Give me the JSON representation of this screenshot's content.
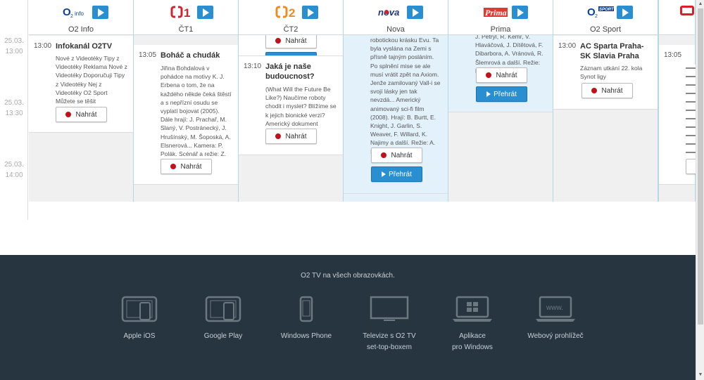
{
  "times": [
    "25.03.",
    "13:00",
    "25.03.",
    "13:30",
    "25.03.",
    "14:00"
  ],
  "channels": {
    "o2info": {
      "name": "O2 Info",
      "prog": {
        "time": "13:00",
        "title": "Infokanál O2TV",
        "desc": "Nové z Videotéky Tipy z Videotéky Reklama Nové z Videotéky Doporučuji Tipy z Videotéky Nej z Videotéky O2 Sport Můžete se těšit",
        "record": "Nahrát"
      }
    },
    "ct1": {
      "name": "ČT1",
      "prog": {
        "time": "13:05",
        "title": "Boháč a chudák",
        "desc": "Jiřina Bohdalová v pohádce na motivy K. J. Erbena o tom, že na každého někde čeká štěstí a s nepřízní osudu se vyplatí bojovat (2005). Dále hrají: J. Prachař, M. Slaný, V. Postránecký, J. Hrušínský, M. Šoposká, A. Elsnerová... Kamera: P. Polák. Scénář a režie: Z. Zelenka",
        "record": "Nahrát"
      }
    },
    "ct2": {
      "name": "ČT2",
      "prev_record": "Nahrát",
      "prog": {
        "time": "13:10",
        "title": "Jaká je naše budoucnost?",
        "desc": "(What Will the Future Be Like?) Naučíme roboty chodit i myslet? Blížíme se k jejich bionické verzi? Americký dokument",
        "record": "Nahrát"
      }
    },
    "nova": {
      "name": "Nova",
      "prog": {
        "desc": "robotickou krásku Evu. Ta byla vyslána na Zemi s přísně tajným posláním. Po splnění mise se ale musí vrátit zpět na Axiom. Jenže zamilovaný Vall-i se svojí lásky jen tak nevzdá... Americký animovaný sci-fi film (2008). Hrají: B. Burtt, E. Knight, J. Garlin, S. Weaver, F. Willard, K. Najimy a další. Režie: A. Stanton",
        "record": "Nahrát",
        "play": "Přehrát"
      }
    },
    "prima": {
      "name": "Prima",
      "prog": {
        "desc": "J. Petrýl, R. Kemr, V. Hlaváčová, J. Dítětová, F. Dibarbora, A. Vránová, R. Šlemrová a další. Režie: B. Zeman",
        "record": "Nahrát",
        "play": "Přehrát"
      }
    },
    "o2sport": {
      "name": "O2 Sport",
      "prog": {
        "time": "13:00",
        "title": "AC Sparta Praha-SK Slavia Praha",
        "desc": "Záznam utkání 22. kola Synot ligy",
        "record": "Nahrát"
      }
    },
    "partial": {
      "time": "13:05"
    }
  },
  "logos": {
    "o2info_small": "info",
    "ct1": "1",
    "ct2": "2",
    "nova": "nova",
    "prima": "Prima",
    "o2sport": "SPORT"
  },
  "footer": {
    "title": "O2 TV na všech obrazovkách.",
    "items": [
      {
        "label": "Apple iOS",
        "icon": "tablet-phone-icon"
      },
      {
        "label": "Google Play",
        "icon": "tablet-phone-icon"
      },
      {
        "label": "Windows Phone",
        "icon": "phone-icon"
      },
      {
        "label": "Televize s O2 TV",
        "label2": "set-top-boxem",
        "icon": "tv-icon"
      },
      {
        "label": "Aplikace",
        "label2": "pro Windows",
        "icon": "windows-laptop-icon"
      },
      {
        "label": "Webový prohlížeč",
        "icon": "www-laptop-icon"
      }
    ]
  },
  "colors": {
    "accent": "#2a8fd0",
    "record_dot": "#c0121a",
    "footer_bg": "#273540",
    "active_bg": "#e3f1fb",
    "ct_red": "#d2232a",
    "ct2_orange": "#f08c1e"
  }
}
